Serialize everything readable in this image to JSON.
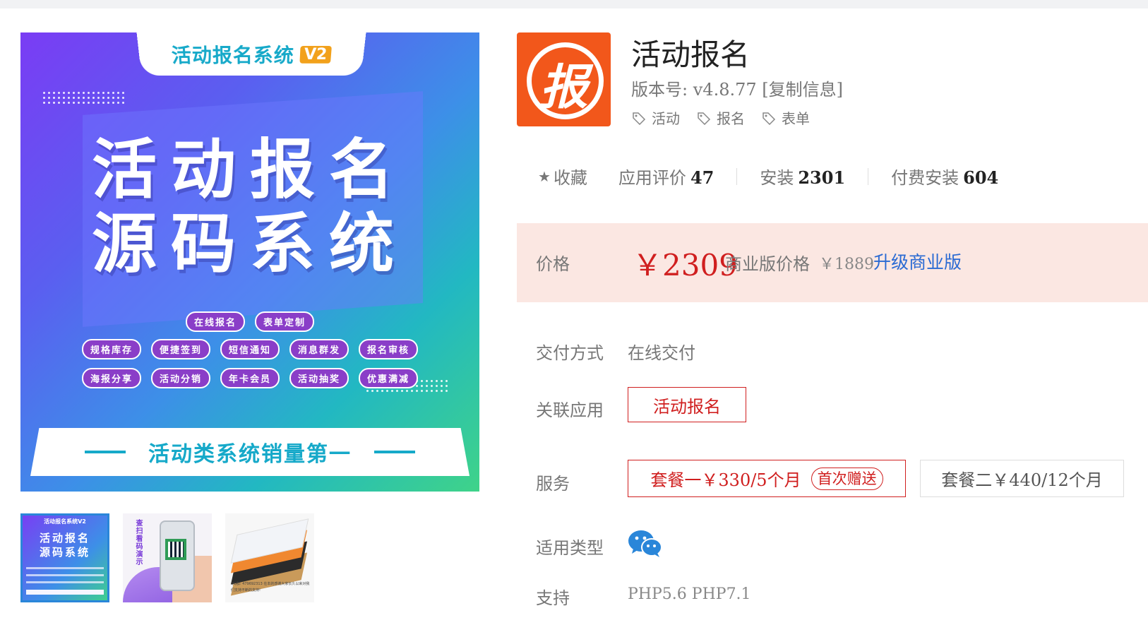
{
  "banner": {
    "tab_text": "活动报名系统",
    "tab_badge": "V2",
    "headline_line1": "活动报名",
    "headline_line2": "源码系统",
    "chips_row1": [
      "在线报名",
      "表单定制"
    ],
    "chips_row2": [
      "规格库存",
      "便捷签到",
      "短信通知",
      "消息群发",
      "报名审核"
    ],
    "chips_row3": [
      "海报分享",
      "活动分销",
      "年卡会员",
      "活动抽奖",
      "优惠满减"
    ],
    "bottom_text": "活动类系统销量第一"
  },
  "thumbnails": {
    "thumb1_title": "活动报名系统V2",
    "thumb1_line1": "活动报名",
    "thumb1_line2": "源码系统",
    "thumb2_side": "查扫看码演示",
    "thumb3_caption": "QQ群: 479692313 在本的感谢大家长久以来对我们支持不断的支持!"
  },
  "app": {
    "icon_glyph": "报",
    "title": "活动报名",
    "version_label": "版本号:",
    "version_value": "v4.8.77",
    "copy_info": "[复制信息]",
    "tags": [
      "活动",
      "报名",
      "表单"
    ]
  },
  "stats": {
    "favorite": "收藏",
    "rating_label": "应用评价",
    "rating_value": "47",
    "install_label": "安装",
    "install_value": "2301",
    "paid_label": "付费安装",
    "paid_value": "604"
  },
  "price": {
    "label": "价格",
    "value": "￥2309",
    "business_label": "商业版价格",
    "business_value": "￥1889",
    "upgrade": "升级商业版"
  },
  "details": {
    "delivery_label": "交付方式",
    "delivery_value": "在线交付",
    "related_label": "关联应用",
    "related_value": "活动报名",
    "service_label": "服务",
    "package1": "套餐一",
    "package1_price": "￥330/5个月",
    "package1_badge": "首次赠送",
    "package2": "套餐二",
    "package2_price": "￥440/12个月",
    "type_label": "适用类型",
    "type_icon": "wechat-icon",
    "support_label": "支持",
    "support_value": "PHP5.6 PHP7.1"
  },
  "colors": {
    "accent_red": "#d01f1f",
    "link_blue": "#2a6ad3",
    "price_bg": "#fbe7e2",
    "wechat_blue": "#2a86d9",
    "icon_orange": "#f2571b"
  }
}
